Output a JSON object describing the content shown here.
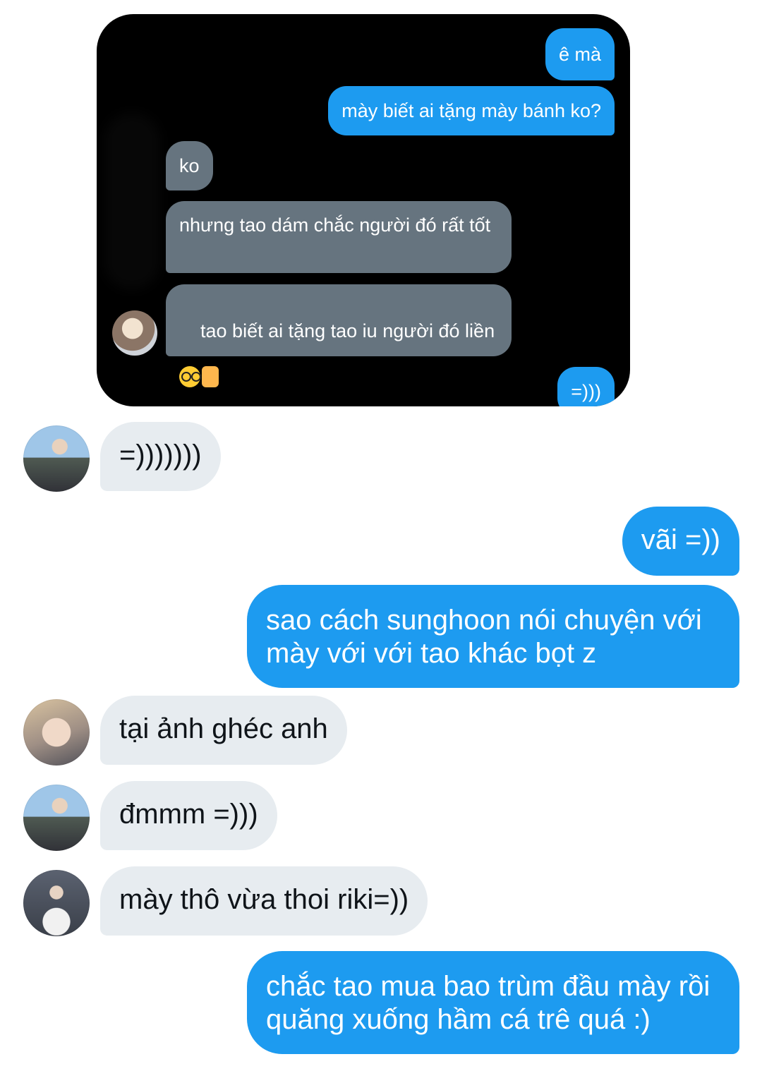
{
  "embedded_screenshot": {
    "messages": [
      {
        "side": "out",
        "text": "ê mà"
      },
      {
        "side": "out",
        "text": "mày biết ai tặng mày bánh ko?"
      },
      {
        "side": "in",
        "text": "ko"
      },
      {
        "side": "in",
        "text": "nhưng tao dám chắc người đó rất tốt"
      },
      {
        "side": "in",
        "text": "tao biết ai tặng tao iu người đó liền",
        "emojis": [
          "nerd-face-icon",
          "thumbs-up-icon"
        ]
      },
      {
        "side": "out",
        "text": "=)))"
      }
    ]
  },
  "messages": [
    {
      "side": "in",
      "avatar": "avatar-a",
      "text": "=)))))))"
    },
    {
      "side": "out",
      "text": "vãi =))"
    },
    {
      "side": "out",
      "text": "sao cách sunghoon nói chuyện với mày với với tao khác bọt z"
    },
    {
      "side": "in",
      "avatar": "avatar-b",
      "text": "tại ảnh ghéc anh"
    },
    {
      "side": "in",
      "avatar": "avatar-a",
      "text": "đmmm =)))"
    },
    {
      "side": "in",
      "avatar": "avatar-c",
      "text": "mày thô vừa thoi riki=))"
    },
    {
      "side": "out",
      "text": "chắc tao mua bao trùm đầu mày rồi quăng xuống hầm cá trê quá :)"
    }
  ],
  "colors": {
    "outgoing_bubble": "#1d9bf0",
    "incoming_bubble": "#e7ecf0",
    "embedded_incoming_bubble": "#66747f",
    "embedded_background": "#000000"
  }
}
